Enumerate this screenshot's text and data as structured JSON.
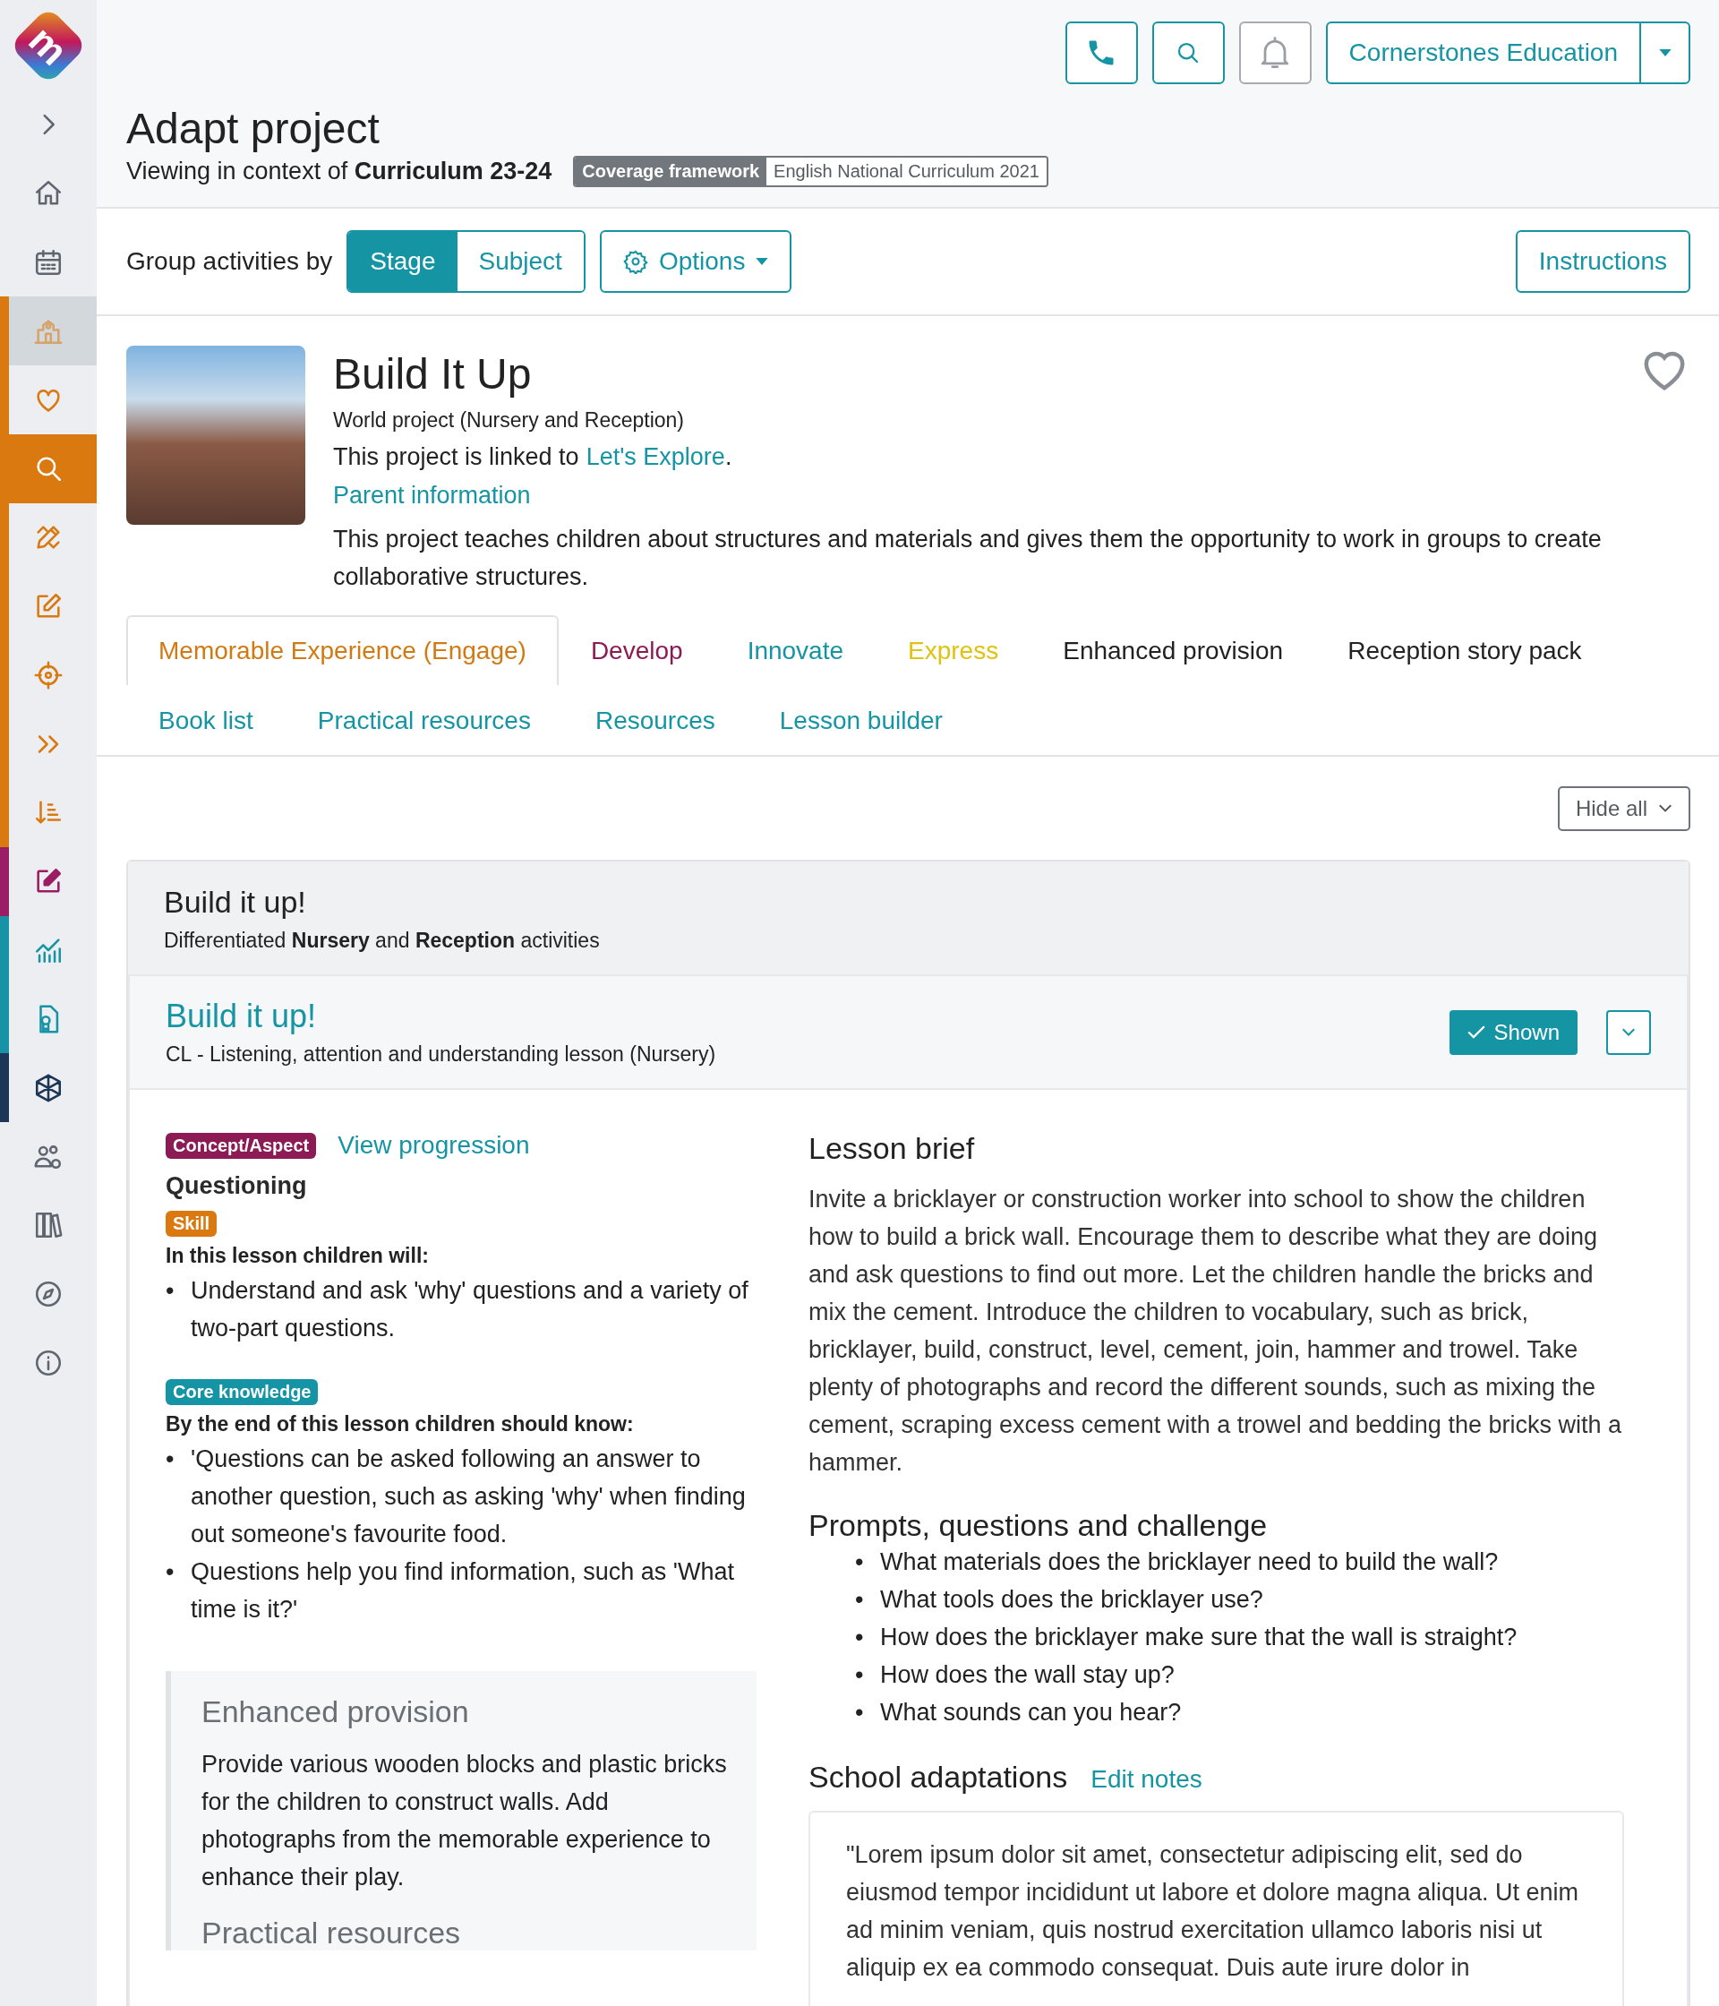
{
  "sidebar": {
    "logo": "m",
    "items": [
      {
        "kind": "link",
        "selected": false
      },
      {
        "kind": "link",
        "selected": false
      },
      {
        "kind": "link",
        "selected": false
      },
      {
        "kind": "heading",
        "selected": false,
        "color": "#d9790f"
      },
      {
        "kind": "link",
        "selected": false,
        "color": "#d9790f"
      },
      {
        "kind": "link",
        "selected": true,
        "color": "#d9790f"
      },
      {
        "kind": "link",
        "selected": false,
        "color": "#d9790f"
      },
      {
        "kind": "link",
        "selected": false,
        "color": "#d9790f"
      },
      {
        "kind": "link",
        "selected": false,
        "color": "#d9790f"
      },
      {
        "kind": "link",
        "selected": false,
        "color": "#d9790f"
      },
      {
        "kind": "link",
        "selected": false,
        "color": "#d9790f"
      },
      {
        "kind": "link",
        "selected": false,
        "color": "#9b1d63"
      },
      {
        "kind": "link",
        "selected": false,
        "color": "#1694a6"
      },
      {
        "kind": "link",
        "selected": false,
        "color": "#1694a6"
      },
      {
        "kind": "link",
        "selected": false,
        "color": "#1d3557"
      },
      {
        "kind": "link",
        "selected": false
      },
      {
        "kind": "link",
        "selected": false
      },
      {
        "kind": "link",
        "selected": false
      },
      {
        "kind": "link",
        "selected": false
      }
    ]
  },
  "top_bar": {
    "organisation": "Cornerstones Education"
  },
  "header": {
    "title": "Adapt project",
    "context": "Viewing in context of **Curriculum 23-24**",
    "framework_label": "Coverage framework",
    "framework_value": "English National Curriculum 2021"
  },
  "toolbar": {
    "group_label": "Group activities by",
    "group_options": [
      {
        "label": "Stage",
        "selected": true
      },
      {
        "label": "Subject",
        "selected": false
      }
    ],
    "options_button": "Options",
    "instructions_button": "Instructions"
  },
  "project": {
    "title": "Build It Up",
    "type": "World project (Nursery and Reception)",
    "linked_prefix": "This project is linked to",
    "linked_project": "Let's Explore",
    "linked_suffix": ".",
    "parent_link": "Parent information",
    "description": "This project teaches children about structures and materials and gives them the opportunity to work in groups to create collaborative structures.",
    "favourite": false
  },
  "tab_rows": [
    [
      {
        "label": "Memorable Experience (Engage)",
        "selected": true,
        "color": "#d17a12"
      },
      {
        "label": "Develop",
        "selected": false,
        "color": "#8b1a55"
      },
      {
        "label": "Innovate",
        "selected": false,
        "color": "#1594a4"
      },
      {
        "label": "Express",
        "selected": false,
        "color": "#e0c210"
      },
      {
        "label": "Enhanced provision",
        "selected": false,
        "color": "#222222"
      },
      {
        "label": "Reception story pack",
        "selected": false,
        "color": "#222222"
      }
    ],
    [
      {
        "label": "Book list",
        "selected": false,
        "color": "#1594a4"
      },
      {
        "label": "Practical resources",
        "selected": false,
        "color": "#1594a4"
      },
      {
        "label": "Resources",
        "selected": false,
        "color": "#1594a4"
      },
      {
        "label": "Lesson builder",
        "selected": false,
        "color": "#1594a4"
      }
    ]
  ],
  "hide_all_button": "Hide all",
  "section": {
    "title": "Build it up!",
    "subtitle": "Differentiated **Nursery** and **Reception** activities"
  },
  "lesson": {
    "bullet": "•",
    "title": "Build it up!",
    "subtitle": "CL - Listening, attention and understanding lesson (Nursery)",
    "shown": true,
    "shown_label": "Shown",
    "concept_badge": "Concept/Aspect",
    "progression_link": "View progression",
    "concept": "Questioning",
    "skill_badge": "Skill",
    "objectives_heading": "In this lesson children will:",
    "objectives": [
      "Understand and ask 'why' questions and a variety of two-part questions."
    ],
    "knowledge_badge": "Core knowledge",
    "knowledge_heading": "By the end of this lesson children should know:",
    "knowledge": [
      "'Questions can be asked following an answer to another question, such as asking 'why' when finding out someone's favourite food.",
      "Questions help you find information, such as 'What time is it?'"
    ],
    "enhanced_provision": {
      "title": "Enhanced provision",
      "text": "Provide various wooden blocks and plastic bricks for the children to construct walls. Add photographs from the memorable experience to enhance their play.",
      "next_title": "Practical resources"
    },
    "brief_title": "Lesson brief",
    "brief": "Invite a bricklayer or construction worker into school to show the children how to build a brick wall. Encourage them to describe what they are doing and ask questions to find out more. Let the children handle the bricks and mix the cement. Introduce the children to vocabulary, such as brick, bricklayer, build, construct, level, cement, join, hammer and trowel. Take plenty of photographs and record the different sounds, such as mixing the cement, scraping excess cement with a trowel and bedding the bricks with a hammer.",
    "prompts_title": "Prompts, questions and challenge",
    "prompts": [
      "What materials does the bricklayer need to build the wall?",
      "What tools does the bricklayer use?",
      "How does the bricklayer make sure that the wall is straight?",
      "How does the wall stay up?",
      "What sounds can you hear?"
    ],
    "adaptations_title": "School adaptations",
    "edit_notes_link": "Edit notes",
    "adaptation_note": "\"Lorem ipsum dolor sit amet, consectetur adipiscing elit, sed do eiusmod tempor incididunt ut labore et dolore magna aliqua. Ut enim ad minim veniam, quis nostrud exercitation ullamco laboris nisi ut aliquip ex ea commodo consequat. Duis aute irure dolor in"
  }
}
